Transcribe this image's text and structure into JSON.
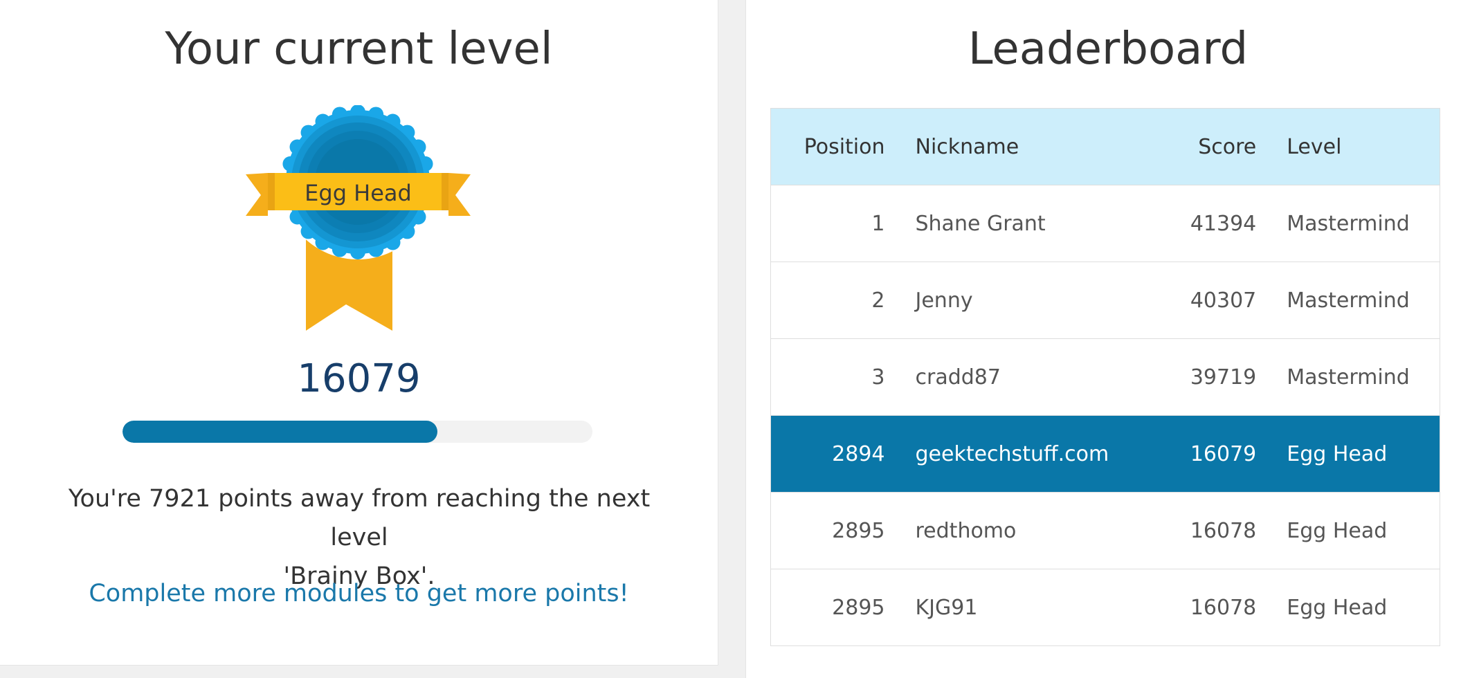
{
  "level_panel": {
    "title": "Your current level",
    "badge_label": "Egg Head",
    "score": "16079",
    "progress": 0.67,
    "away_text_line1": "You're 7921 points away from reaching the next level",
    "away_text_line2": "'Brainy Box'.",
    "cta_link": "Complete more modules to get more points!"
  },
  "leaderboard": {
    "title": "Leaderboard",
    "columns": {
      "position": "Position",
      "nickname": "Nickname",
      "score": "Score",
      "level": "Level"
    },
    "rows": [
      {
        "position": "1",
        "nickname": "Shane Grant",
        "score": "41394",
        "level": "Mastermind"
      },
      {
        "position": "2",
        "nickname": "Jenny",
        "score": "40307",
        "level": "Mastermind"
      },
      {
        "position": "3",
        "nickname": "cradd87",
        "score": "39719",
        "level": "Mastermind"
      },
      {
        "position": "2894",
        "nickname": "geektechstuff.com",
        "score": "16079",
        "level": "Egg Head",
        "current_user": true
      },
      {
        "position": "2895",
        "nickname": "redthomo",
        "score": "16078",
        "level": "Egg Head"
      },
      {
        "position": "2895",
        "nickname": "KJG91",
        "score": "16078",
        "level": "Egg Head"
      }
    ]
  },
  "colors": {
    "accent": "#0a77a8",
    "header_bg": "#cdeefb",
    "badge_ribbon": "#f5ae1b",
    "badge_circle": "#1aa7e8"
  },
  "icons": {
    "badge": "rosette-badge-icon"
  }
}
